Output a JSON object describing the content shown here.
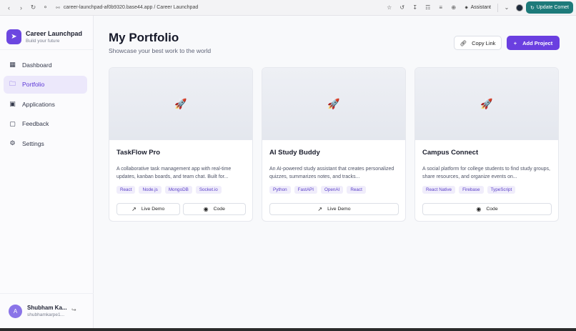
{
  "browser": {
    "url": "career-launchpad-af0b9320.base44.app / Career Launchpad",
    "assistant_label": "Assistant",
    "update_label": "Update Comet"
  },
  "brand": {
    "title": "Career Launchpad",
    "subtitle": "Build your future",
    "icon": "rocket-icon"
  },
  "nav": [
    {
      "label": "Dashboard",
      "icon": "grid-icon",
      "active": false
    },
    {
      "label": "Portfolio",
      "icon": "folder-icon",
      "active": true
    },
    {
      "label": "Applications",
      "icon": "briefcase-icon",
      "active": false
    },
    {
      "label": "Feedback",
      "icon": "message-icon",
      "active": false
    },
    {
      "label": "Settings",
      "icon": "gear-icon",
      "active": false
    }
  ],
  "user": {
    "initial": "A",
    "name": "Shubham Ka...",
    "email": "shubhamkarpe1..."
  },
  "page": {
    "title": "My Portfolio",
    "subtitle": "Showcase your best work to the world",
    "copy_label": "Copy Link",
    "add_label": "Add Project"
  },
  "projects": [
    {
      "title": "TaskFlow Pro",
      "desc": "A collaborative task management app with real-time updates, kanban boards, and team chat. Built for...",
      "tags": [
        "React",
        "Node.js",
        "MongoDB",
        "Socket.io"
      ],
      "live": "Live Demo",
      "code": "Code"
    },
    {
      "title": "AI Study Buddy",
      "desc": "An AI-powered study assistant that creates personalized quizzes, summarizes notes, and tracks...",
      "tags": [
        "Python",
        "FastAPI",
        "OpenAI",
        "React"
      ],
      "live": "Live Demo",
      "code": ""
    },
    {
      "title": "Campus Connect",
      "desc": "A social platform for college students to find study groups, share resources, and organize events on...",
      "tags": [
        "React Native",
        "Firebase",
        "TypeScript"
      ],
      "live": "",
      "code": "Code"
    }
  ],
  "colors": {
    "accent": "#6a3fe0",
    "active_bg": "#ece8fb",
    "update_btn": "#1d7a7a"
  }
}
